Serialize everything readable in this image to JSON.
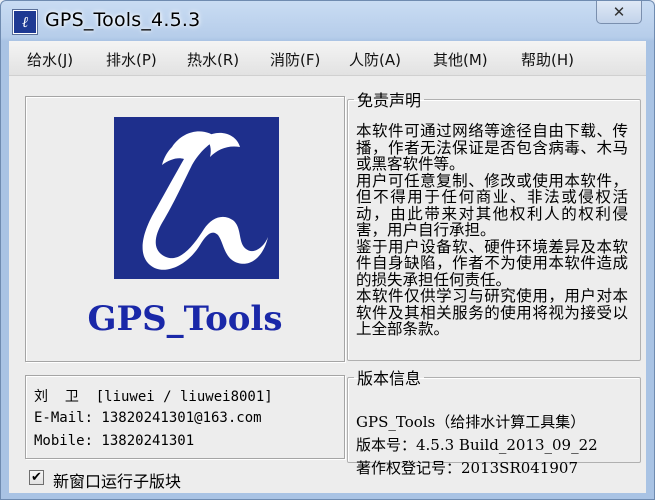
{
  "window": {
    "title": "GPS_Tools_4.5.3",
    "close_glyph": "✕",
    "icon": "app-logo-icon"
  },
  "menu": [
    {
      "label": "给水(J)"
    },
    {
      "label": "排水(P)"
    },
    {
      "label": "热水(R)"
    },
    {
      "label": "消防(F)"
    },
    {
      "label": "人防(A)"
    },
    {
      "label": "其他(M)"
    },
    {
      "label": "帮助(H)"
    }
  ],
  "logo": {
    "brand": "GPS_Tools",
    "background": "#1e2f8c",
    "brand_color": "#1a28a8"
  },
  "disclaimer": {
    "legend": "免责声明",
    "paragraphs": [
      "本软件可通过网络等途径自由下载、传播，作者无法保证是否包含病毒、木马或黑客软件等。",
      "用户可任意复制、修改或使用本软件，但不得用于任何商业、非法或侵权活动，由此带来对其他权利人的权利侵害，用户自行承担。",
      "鉴于用户设备软、硬件环境差异及本软件自身缺陷，作者不为使用本软件造成的损失承担任何责任。",
      "本软件仅供学习与研究使用，用户对本软件及其相关服务的使用将视为接受以上全部条款。"
    ]
  },
  "contact": {
    "name_line": "刘  卫  [liuwei / liuwei8001]",
    "email_line": "E-Mail: 13820241301@163.com",
    "mobile_line": "Mobile: 13820241301"
  },
  "version": {
    "legend": "版本信息",
    "product_line": "GPS_Tools（给排水计算工具集）",
    "version_line": "版本号：4.5.3  Build_2013_09_22",
    "copyright_line": "著作权登记号：2013SR041907"
  },
  "options": {
    "new_window_label": "新窗口运行子版块",
    "new_window_checked": true,
    "check_glyph": "✔"
  }
}
